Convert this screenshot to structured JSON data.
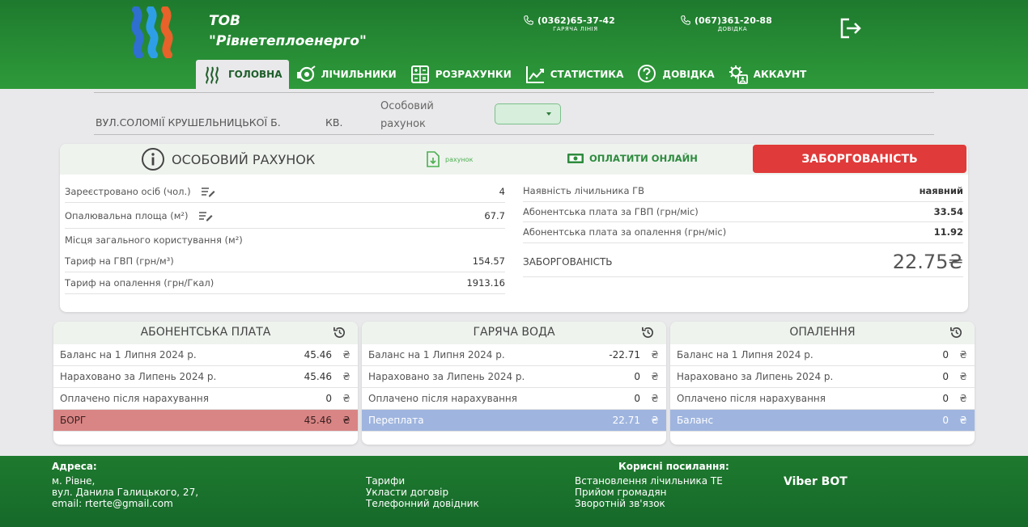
{
  "header": {
    "company_line1": "ТОВ",
    "company_line2": "\"Рівнетеплоенерго\"",
    "phone1": {
      "number": "(0362)65-37-42",
      "label": "ГАРЯЧА ЛІНІЯ"
    },
    "phone2": {
      "number": "(067)361-20-88",
      "label": "ДОВІДКА"
    }
  },
  "nav": [
    {
      "label": "ГОЛОВНА",
      "icon": "heat-waves-icon"
    },
    {
      "label": "ЛІЧИЛЬНИКИ",
      "icon": "meter-icon"
    },
    {
      "label": "РОЗРАХУНКИ",
      "icon": "calculator-icon"
    },
    {
      "label": "СТАТИСТИКА",
      "icon": "chart-icon"
    },
    {
      "label": "ДОВІДКА",
      "icon": "question-icon"
    },
    {
      "label": "АККАУНТ",
      "icon": "account-gear-icon"
    }
  ],
  "address": {
    "street": "ВУЛ.СОЛОМІЇ КРУШЕЛЬНИЦЬКОЇ Б.",
    "kv": "КВ.",
    "account_label_1": "Особовий",
    "account_label_2": "рахунок",
    "account_value": ""
  },
  "account_panel": {
    "title": "ОСОБОВИЙ РАХУНОК",
    "doc_label": "рахунок",
    "pay_label": "ОПЛАТИТИ ОНЛАЙН",
    "debt_button": "ЗАБОРГОВАНІСТЬ",
    "left_rows": [
      {
        "label": "Зареєстровано осіб (чол.)",
        "value": "4"
      },
      {
        "label": "Опалювальна площа (м²)",
        "value": "67.7"
      },
      {
        "label": "Місця загального користування (м²)",
        "value": ""
      },
      {
        "label": "Тариф на ГВП (грн/м³)",
        "value": "154.57"
      },
      {
        "label": "Тариф на опалення (грн/Гкал)",
        "value": "1913.16"
      }
    ],
    "right_rows": [
      {
        "label": "Наявність лічильника ГВ",
        "value": "наявний"
      },
      {
        "label": "Абонентська плата за ГВП (грн/міс)",
        "value": "33.54"
      },
      {
        "label": "Абонентська плата за опалення (грн/міс)",
        "value": "11.92"
      }
    ],
    "debt_label": "ЗАБОРГОВАНІСТЬ",
    "debt_value": "22.75₴"
  },
  "cards": [
    {
      "title": "АБОНЕНТСЬКА ПЛАТА",
      "rows": [
        {
          "label": "Баланс на 1 Липня 2024 р.",
          "value": "45.46"
        },
        {
          "label": "Нараховано за Липень 2024 р.",
          "value": "45.46"
        },
        {
          "label": "Оплачено після нарахування",
          "value": "0"
        },
        {
          "label": "БОРГ",
          "value": "45.46"
        }
      ]
    },
    {
      "title": "ГАРЯЧА ВОДА",
      "rows": [
        {
          "label": "Баланс на 1 Липня 2024 р.",
          "value": "-22.71"
        },
        {
          "label": "Нараховано за Липень 2024 р.",
          "value": "0"
        },
        {
          "label": "Оплачено після нарахування",
          "value": "0"
        },
        {
          "label": "Переплата",
          "value": "22.71"
        }
      ]
    },
    {
      "title": "ОПАЛЕННЯ",
      "rows": [
        {
          "label": "Баланс на 1 Липня 2024 р.",
          "value": "0"
        },
        {
          "label": "Нараховано за Липень 2024 р.",
          "value": "0"
        },
        {
          "label": "Оплачено після нарахування",
          "value": "0"
        },
        {
          "label": "Баланс",
          "value": "0"
        }
      ]
    }
  ],
  "currency": "₴",
  "footer": {
    "address_heading": "Адреса:",
    "address_lines": [
      "м. Рівне,",
      "вул. Данила Галицького, 27,",
      "email: rterte@gmail.com"
    ],
    "links_col1": [
      "Тарифи",
      "Укласти договір",
      "Телефонний довідник"
    ],
    "useful_heading": "Корисні посилання:",
    "links_col2": [
      "Встановлення лічильника ТЕ",
      "Прийом громадян",
      "Зворотній зв'язок"
    ],
    "viber": "Viber BOT"
  },
  "colors": {
    "brand_green": "#2e9a3a",
    "debt_red": "#e03a3a",
    "debt_row": "#d98585",
    "over_row": "#9fb5df"
  }
}
